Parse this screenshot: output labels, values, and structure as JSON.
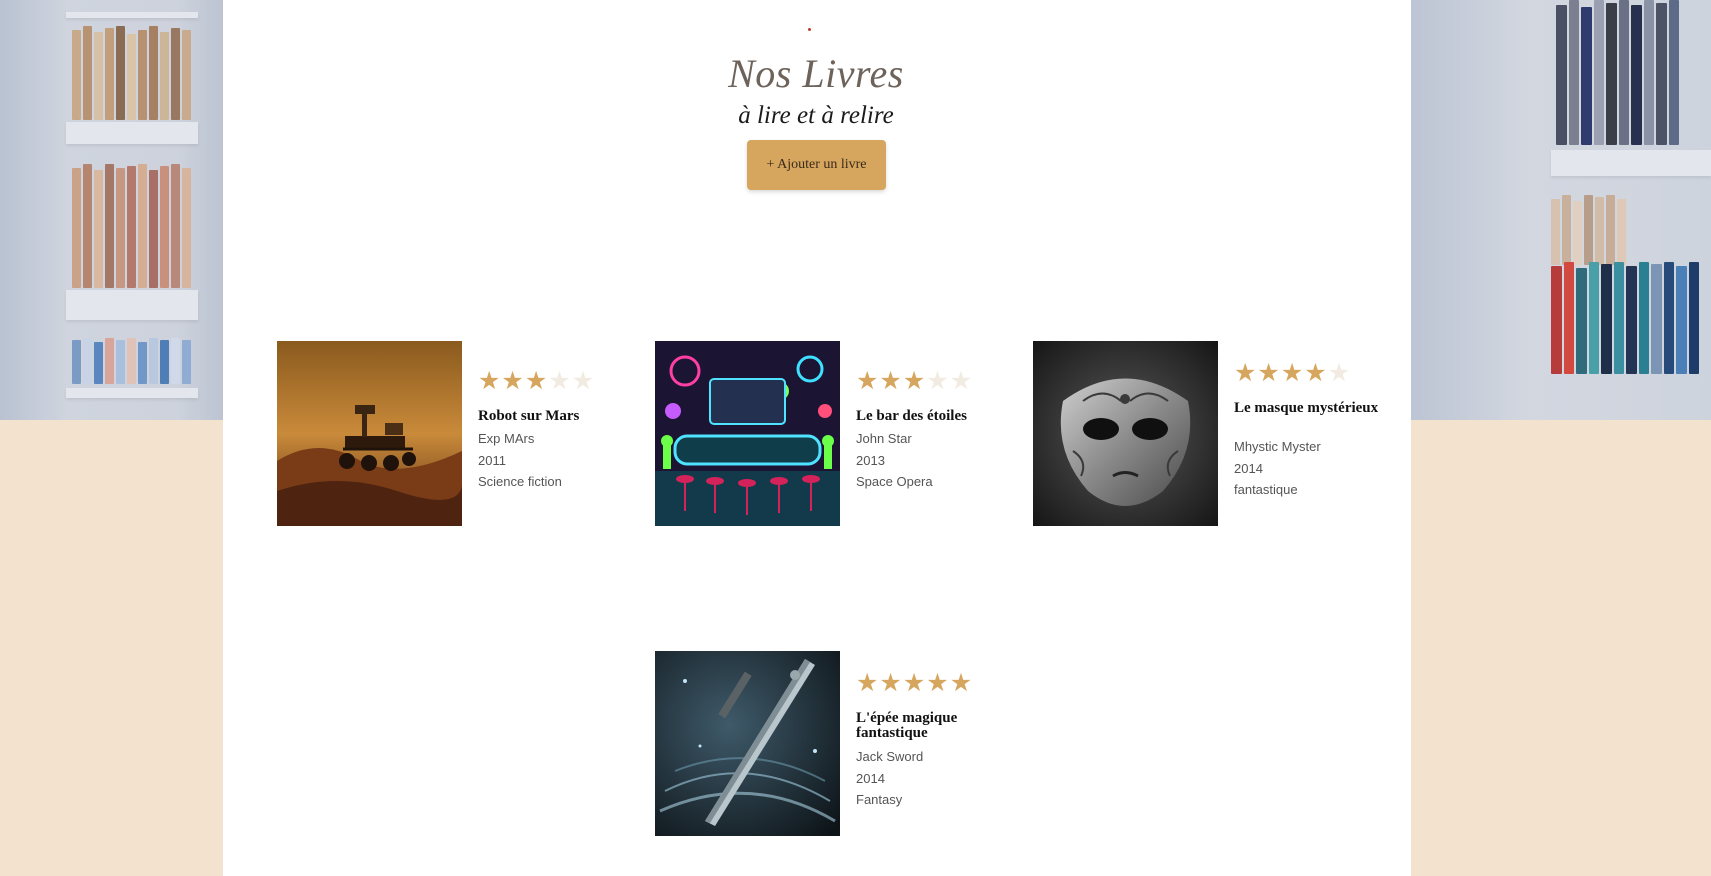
{
  "header": {
    "title": "Nos Livres",
    "subtitle": "à lire et à relire",
    "add_button_label": "+ Ajouter un livre"
  },
  "books": [
    {
      "title": "Robot sur Mars",
      "author": "Exp MArs",
      "year": "2011",
      "genre": "Science fiction",
      "rating": 3,
      "max_rating": 5,
      "cover_icon": "mars-rover-illustration"
    },
    {
      "title": "Le bar des étoiles",
      "author": "John Star",
      "year": "2013",
      "genre": "Space Opera",
      "rating": 3,
      "max_rating": 5,
      "cover_icon": "space-bar-illustration"
    },
    {
      "title": "Le masque mystérieux",
      "author": "Mhystic Myster",
      "year": "2014",
      "genre": "fantastique",
      "rating": 4,
      "max_rating": 5,
      "cover_icon": "venetian-mask-illustration"
    },
    {
      "title": "L'épée magique fantastique",
      "author": "Jack Sword",
      "year": "2014",
      "genre": "Fantasy",
      "rating": 5,
      "max_rating": 5,
      "cover_icon": "magic-sword-illustration"
    }
  ],
  "colors": {
    "accent": "#d6a55e",
    "page_background": "#f3e2cd",
    "panel_background": "#ffffff",
    "star_off": "#f1ebe1"
  }
}
